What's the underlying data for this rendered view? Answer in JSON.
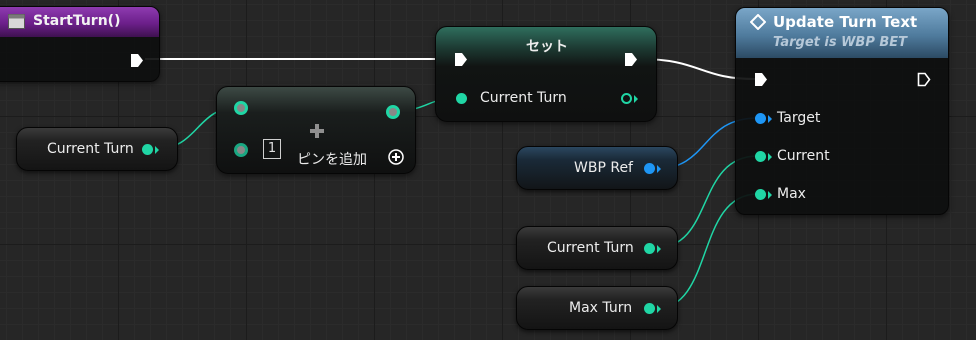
{
  "colors": {
    "exec_wire": "#ffffff",
    "data_wire": "#20d6a5",
    "object_wire": "#1e96f5",
    "event_header": "#6c1f8a",
    "function_header": "#4f7b9d"
  },
  "nodes": {
    "start_turn": {
      "title": "StartTurn()",
      "icon": "event-icon"
    },
    "add_node": {
      "index_label": "1",
      "add_pin_label": "ピンを追加",
      "icon": "plus-icon"
    },
    "set_node": {
      "title": "セット",
      "pin_label": "Current Turn"
    },
    "update_turn_text": {
      "title": "Update Turn Text",
      "subtitle": "Target is WBP BET",
      "pins": {
        "target": "Target",
        "current": "Current",
        "max": "Max"
      }
    }
  },
  "variables": {
    "current_turn_left": "Current Turn",
    "wbp_ref": "WBP Ref",
    "current_turn_bottom": "Current Turn",
    "max_turn": "Max Turn"
  }
}
